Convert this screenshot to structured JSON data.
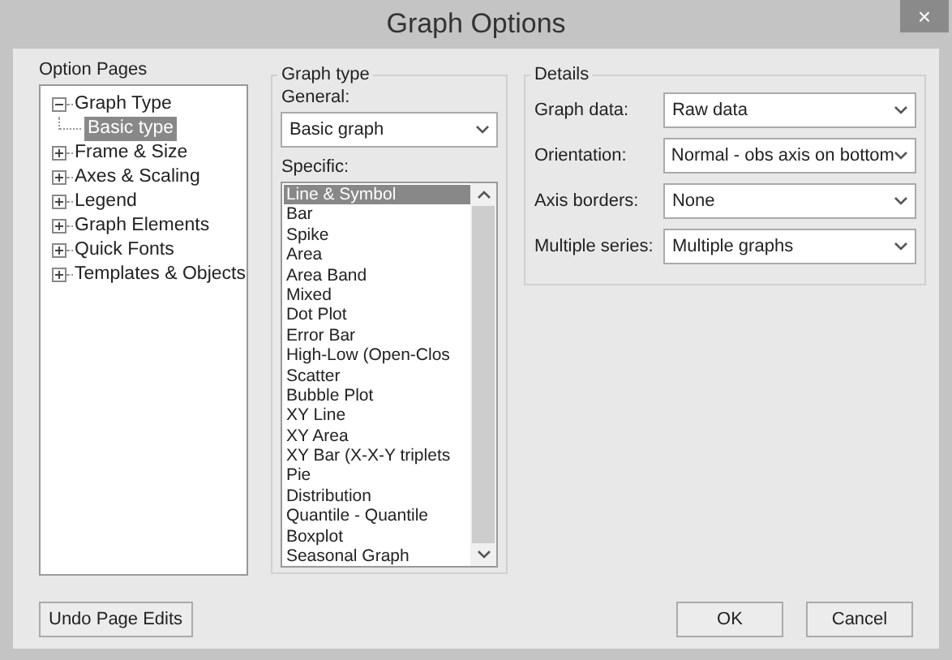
{
  "window": {
    "title": "Graph Options",
    "close": "×"
  },
  "option_pages": {
    "label": "Option Pages",
    "tree": [
      {
        "label": "Graph Type",
        "expanded": true,
        "selected": false,
        "children": [
          {
            "label": "Basic type",
            "selected": true
          }
        ]
      },
      {
        "label": "Frame & Size",
        "expanded": false,
        "selected": false
      },
      {
        "label": "Axes & Scaling",
        "expanded": false,
        "selected": false
      },
      {
        "label": "Legend",
        "expanded": false,
        "selected": false
      },
      {
        "label": "Graph Elements",
        "expanded": false,
        "selected": false
      },
      {
        "label": "Quick Fonts",
        "expanded": false,
        "selected": false
      },
      {
        "label": "Templates & Objects",
        "expanded": false,
        "selected": false
      }
    ]
  },
  "graph_type": {
    "label": "Graph type",
    "general_label": "General:",
    "general_value": "Basic graph",
    "specific_label": "Specific:",
    "specific_items": [
      {
        "label": "Line & Symbol",
        "selected": true
      },
      {
        "label": "Bar",
        "selected": false
      },
      {
        "label": "Spike",
        "selected": false
      },
      {
        "label": "Area",
        "selected": false
      },
      {
        "label": "Area Band",
        "selected": false
      },
      {
        "label": "Mixed",
        "selected": false
      },
      {
        "label": "Dot Plot",
        "selected": false
      },
      {
        "label": "Error Bar",
        "selected": false
      },
      {
        "label": "High-Low (Open-Clos",
        "selected": false
      },
      {
        "label": "Scatter",
        "selected": false
      },
      {
        "label": "Bubble Plot",
        "selected": false
      },
      {
        "label": "XY Line",
        "selected": false
      },
      {
        "label": "XY Area",
        "selected": false
      },
      {
        "label": "XY Bar (X-X-Y triplets",
        "selected": false
      },
      {
        "label": "Pie",
        "selected": false
      },
      {
        "label": "Distribution",
        "selected": false
      },
      {
        "label": "Quantile - Quantile",
        "selected": false
      },
      {
        "label": "Boxplot",
        "selected": false
      },
      {
        "label": "Seasonal Graph",
        "selected": false
      }
    ]
  },
  "details": {
    "label": "Details",
    "fields": [
      {
        "label": "Graph data:",
        "value": "Raw data"
      },
      {
        "label": "Orientation:",
        "value": "Normal - obs axis on bottom"
      },
      {
        "label": "Axis borders:",
        "value": "None"
      },
      {
        "label": "Multiple series:",
        "value": "Multiple graphs"
      }
    ]
  },
  "buttons": {
    "undo": "Undo Page Edits",
    "ok": "OK",
    "cancel": "Cancel"
  }
}
